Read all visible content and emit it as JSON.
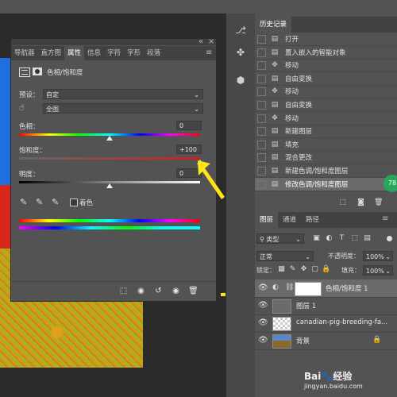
{
  "properties": {
    "tabs": [
      "导航器",
      "直方图",
      "属性",
      "信息",
      "字符",
      "字形",
      "段落"
    ],
    "active_tab": "属性",
    "adjustment_title": "色相/饱和度",
    "preset_label": "预设：",
    "preset_value": "自定",
    "range_value": "全图",
    "hue_label": "色相：",
    "hue_value": "0",
    "saturation_label": "饱和度：",
    "saturation_value": "+100",
    "lightness_label": "明度：",
    "lightness_value": "0",
    "colorize_label": "着色",
    "slider_positions": {
      "hue": 0.5,
      "saturation": 1.0,
      "lightness": 0.5
    }
  },
  "history": {
    "tab": "历史记录",
    "items": [
      {
        "icon": "doc-icon",
        "label": "打开"
      },
      {
        "icon": "doc-icon",
        "label": "置入嵌入的智能对象"
      },
      {
        "icon": "move-icon",
        "label": "移动"
      },
      {
        "icon": "doc-icon",
        "label": "自由变换"
      },
      {
        "icon": "move-icon",
        "label": "移动"
      },
      {
        "icon": "doc-icon",
        "label": "自由变换"
      },
      {
        "icon": "move-icon",
        "label": "移动"
      },
      {
        "icon": "doc-icon",
        "label": "新建图层"
      },
      {
        "icon": "doc-icon",
        "label": "填充"
      },
      {
        "icon": "doc-icon",
        "label": "混合更改"
      },
      {
        "icon": "doc-icon",
        "label": "新建色调/饱和度图层"
      },
      {
        "icon": "doc-icon",
        "label": "修改色调/饱和度图层"
      }
    ],
    "badge": "78"
  },
  "layers": {
    "tabs": [
      "图层",
      "通道",
      "路径"
    ],
    "filter_label": "类型",
    "blend_mode": "正常",
    "opacity_label": "不透明度：",
    "opacity_value": "100%",
    "lock_label": "锁定：",
    "fill_label": "填充：",
    "fill_value": "100%",
    "items": [
      {
        "name": "色相/饱和度 1"
      },
      {
        "name": "图层 1"
      },
      {
        "name": "canadian-pig-breeding-fa..."
      },
      {
        "name": "背景"
      }
    ]
  },
  "watermark": {
    "brand": "Bai",
    "brand2": "经验",
    "url": "jingyan.baidu.com"
  },
  "colors": {
    "arrow": "#ffe419",
    "panel": "#535353",
    "selected": "#6a6a6a",
    "badge": "#25a85c"
  }
}
